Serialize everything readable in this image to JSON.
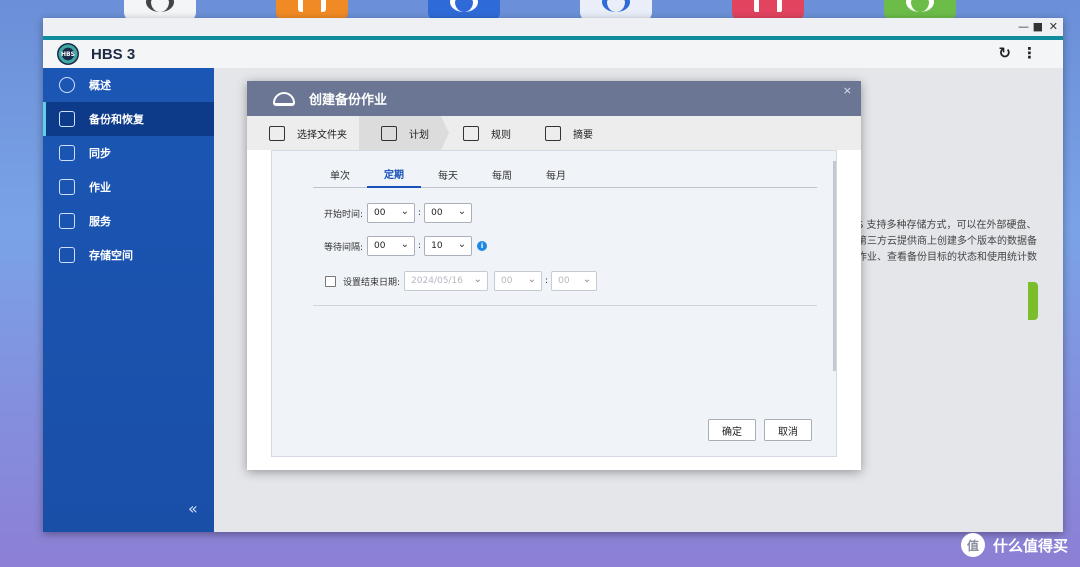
{
  "window": {
    "app_title": "HBS 3",
    "logo_text": "HBS",
    "min_glyph": "—",
    "max_glyph": "■",
    "close_glyph": "✕",
    "refresh_glyph": "↻",
    "more_glyph": "⋮"
  },
  "sidebar": {
    "items": [
      {
        "label": "概述",
        "icon": "dashboard-icon"
      },
      {
        "label": "备份和恢复",
        "icon": "backup-restore-icon",
        "active": true
      },
      {
        "label": "同步",
        "icon": "sync-icon"
      },
      {
        "label": "作业",
        "icon": "jobs-icon"
      },
      {
        "label": "服务",
        "icon": "services-icon"
      },
      {
        "label": "存储空间",
        "icon": "storage-icon"
      }
    ],
    "collapse_glyph": "«"
  },
  "background": {
    "text_lines": [
      "S 支持多种存储方式，可以在外部硬盘、",
      "第三方云提供商上创建多个版本的数据备",
      "作业、查看备份目标的状态和使用统计数"
    ]
  },
  "modal": {
    "title": "创建备份作业",
    "close_glyph": "×",
    "steps": [
      {
        "label": "选择文件夹",
        "icon": "folder-select-icon"
      },
      {
        "label": "计划",
        "icon": "calendar-icon",
        "active": true
      },
      {
        "label": "规则",
        "icon": "sliders-icon"
      },
      {
        "label": "摘要",
        "icon": "clipboard-icon"
      }
    ],
    "tabs": [
      {
        "label": "单次"
      },
      {
        "label": "定期",
        "active": true
      },
      {
        "label": "每天"
      },
      {
        "label": "每周"
      },
      {
        "label": "每月"
      }
    ],
    "start_time": {
      "label": "开始时间:",
      "hour": "00",
      "minute": "00"
    },
    "interval": {
      "label": "等待间隔:",
      "hour": "00",
      "minute": "10"
    },
    "end_date": {
      "label": "设置结束日期:",
      "date": "2024/05/16",
      "hour": "00",
      "minute": "00",
      "checked": false
    },
    "ok_label": "确定",
    "cancel_label": "取消",
    "dropdown_glyph": "⌄",
    "info_glyph": "i"
  },
  "watermark": {
    "text": "什么值得买",
    "glyph": "值"
  }
}
